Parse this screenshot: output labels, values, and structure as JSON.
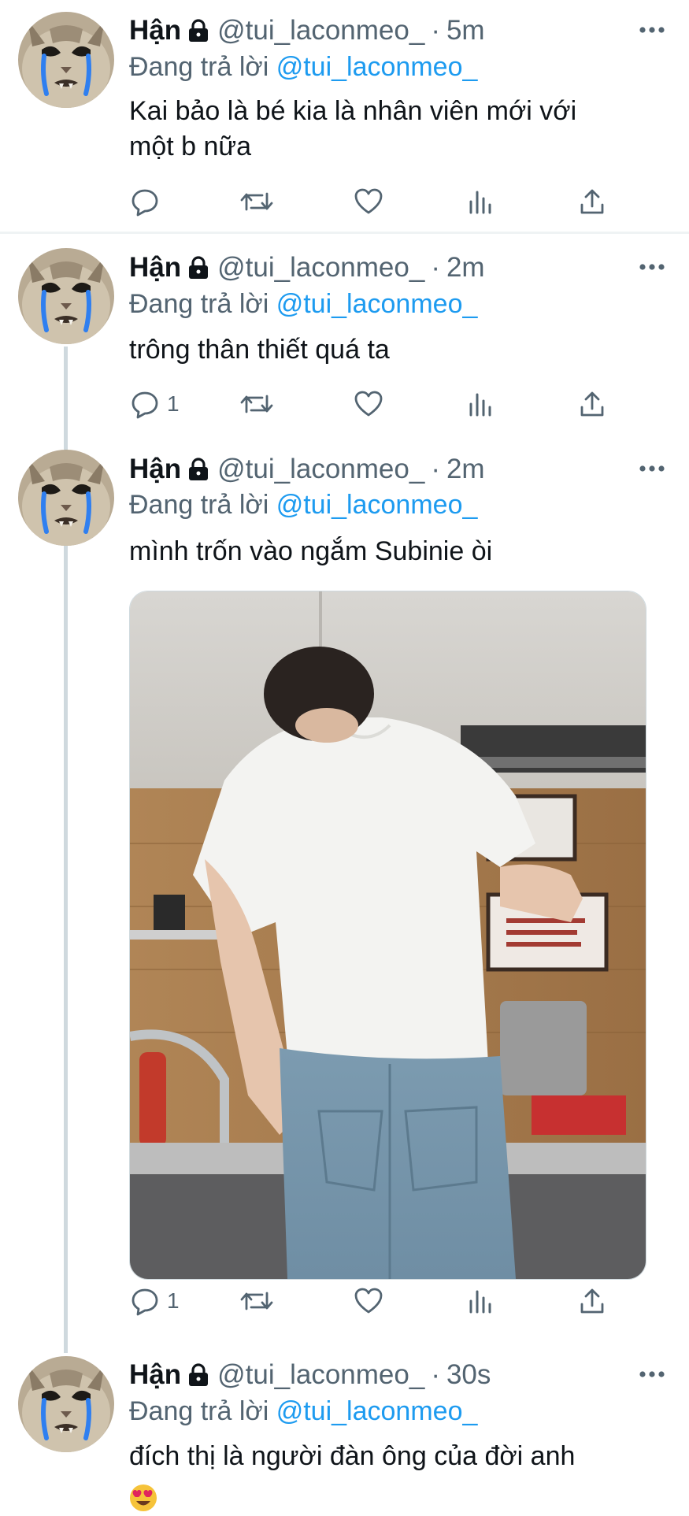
{
  "tweets": [
    {
      "name": "Hận",
      "handle": "@tui_laconmeo_",
      "dot": "·",
      "time": "5m",
      "replying_prefix": "Đang trả lời",
      "replying_to": "@tui_laconmeo_",
      "text_lines": [
        "Kai bảo là bé kia là nhân viên mới với",
        "một b nữa"
      ],
      "reply_count": ""
    },
    {
      "name": "Hận",
      "handle": "@tui_laconmeo_",
      "dot": "·",
      "time": "2m",
      "replying_prefix": "Đang trả lời",
      "replying_to": "@tui_laconmeo_",
      "text_lines": [
        "trông thân thiết quá ta"
      ],
      "reply_count": "1"
    },
    {
      "name": "Hận",
      "handle": "@tui_laconmeo_",
      "dot": "·",
      "time": "2m",
      "replying_prefix": "Đang trả lời",
      "replying_to": "@tui_laconmeo_",
      "text_lines": [
        "mình trốn vào ngắm Subinie òi"
      ],
      "reply_count": "1",
      "media": "photo-man-in-white-shirt-kitchen"
    },
    {
      "name": "Hận",
      "handle": "@tui_laconmeo_",
      "dot": "·",
      "time": "30s",
      "replying_prefix": "Đang trả lời",
      "replying_to": "@tui_laconmeo_",
      "text_lines": [
        "đích thị là người đàn ông của đời anh"
      ],
      "emoji": "😍"
    }
  ],
  "icons": {
    "avatar": "crying-cat-avatar",
    "lock": "lock-icon",
    "more": "more-icon",
    "reply": "reply-icon",
    "retweet": "retweet-icon",
    "like": "heart-icon",
    "views": "views-icon",
    "share": "share-icon"
  },
  "colors": {
    "mention": "#1d9bf0",
    "secondary_text": "#536471",
    "primary_text": "#0f1419",
    "thread_line": "#cfd9de",
    "divider": "#eff3f4"
  }
}
